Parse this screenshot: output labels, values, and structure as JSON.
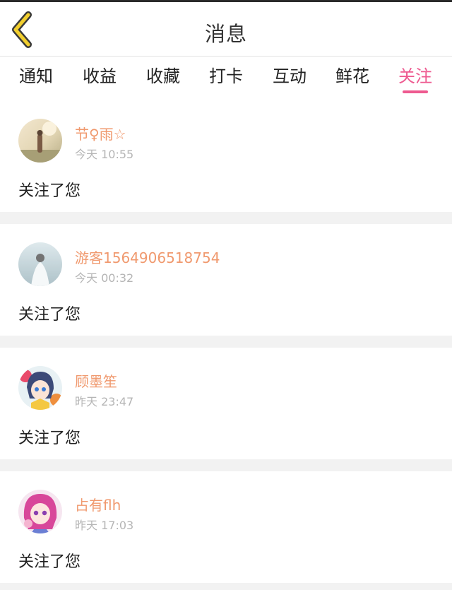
{
  "header": {
    "title": "消息",
    "back_icon": "chevron-left-icon",
    "back_icon_color": "#f2cf2e"
  },
  "tabs": [
    {
      "label": "通知",
      "active": false
    },
    {
      "label": "收益",
      "active": false
    },
    {
      "label": "收藏",
      "active": false
    },
    {
      "label": "打卡",
      "active": false
    },
    {
      "label": "互动",
      "active": false
    },
    {
      "label": "鲜花",
      "active": false
    },
    {
      "label": "关注",
      "active": true
    }
  ],
  "colors": {
    "accent": "#ee5a90",
    "username": "#f0996e",
    "timestamp": "#b5b5b5"
  },
  "messages": [
    {
      "username": "节♀雨☆",
      "time": "今天 10:55",
      "text": "关注了您"
    },
    {
      "username": "游客1564906518754",
      "time": "今天 00:32",
      "text": "关注了您"
    },
    {
      "username": "顾墨笙",
      "time": "昨天 23:47",
      "text": "关注了您"
    },
    {
      "username": "占有flh",
      "time": "昨天 17:03",
      "text": "关注了您"
    }
  ]
}
